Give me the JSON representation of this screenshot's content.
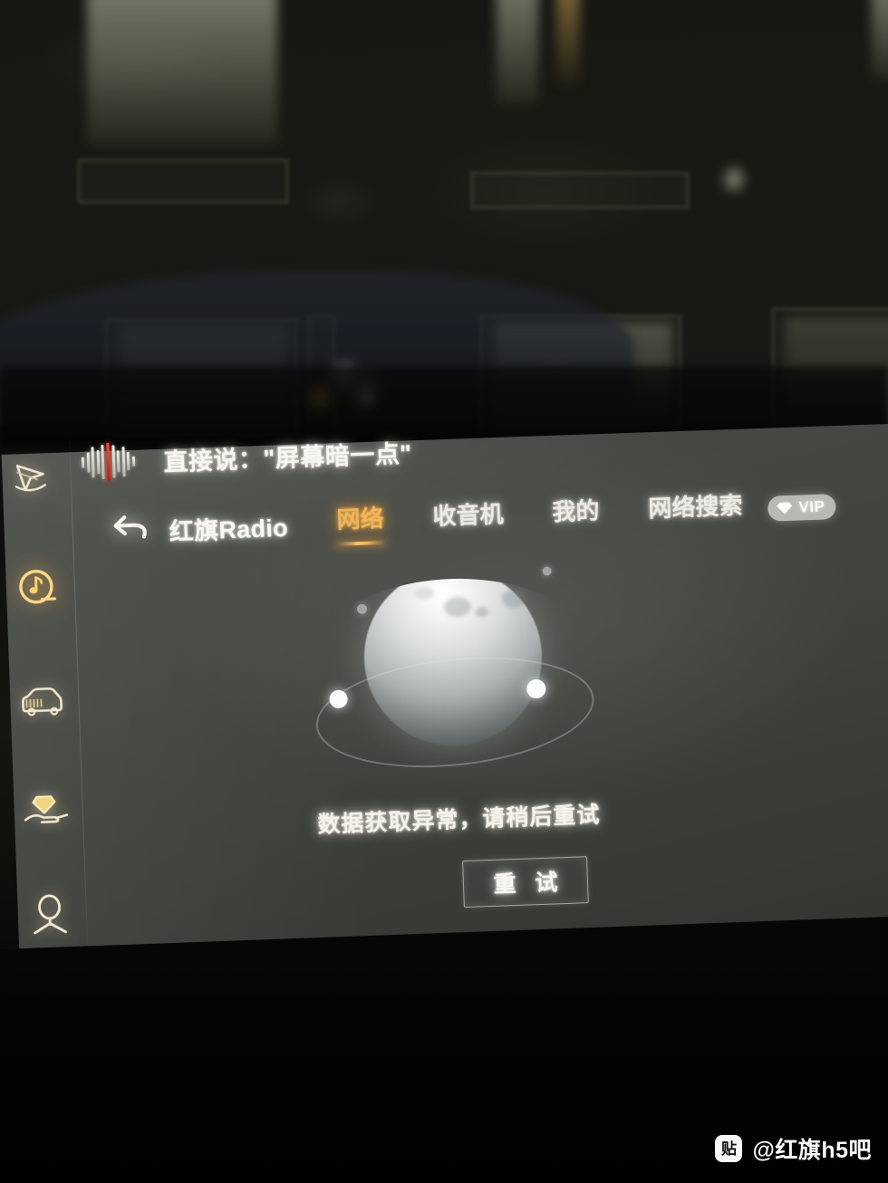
{
  "voice_hint": {
    "icon": "voice-waveform-icon",
    "text": "直接说：\"屏幕暗一点\""
  },
  "nav": {
    "back_icon": "back-arrow-icon",
    "app_title": "红旗Radio",
    "tabs": [
      {
        "label": "网络",
        "active": true
      },
      {
        "label": "收音机",
        "active": false
      },
      {
        "label": "我的",
        "active": false
      },
      {
        "label": "网络搜索",
        "active": false
      }
    ],
    "vip_badge": {
      "label": "VIP",
      "icon": "diamond-icon"
    }
  },
  "sidebar": {
    "items": [
      {
        "name": "navigation",
        "icon": "navigation-arrow-icon",
        "active": false
      },
      {
        "name": "media",
        "icon": "music-note-circle-icon",
        "active": true
      },
      {
        "name": "vehicle",
        "icon": "car-icon",
        "active": false
      },
      {
        "name": "rewards",
        "icon": "diamond-on-hand-icon",
        "active": false
      },
      {
        "name": "profile",
        "icon": "user-icon",
        "active": false
      }
    ]
  },
  "main": {
    "illustration": "planet-orbit-empty-state-icon",
    "error_message": "数据获取异常，请稍后重试",
    "retry_label": "重 试"
  },
  "watermark": {
    "logo_text": "贴",
    "handle": "@红旗h5吧"
  },
  "colors": {
    "accent": "#f0b45a",
    "screen_bg": "#45474a",
    "text": "#f7f6f1",
    "waveform_red": "#ff4b33"
  }
}
